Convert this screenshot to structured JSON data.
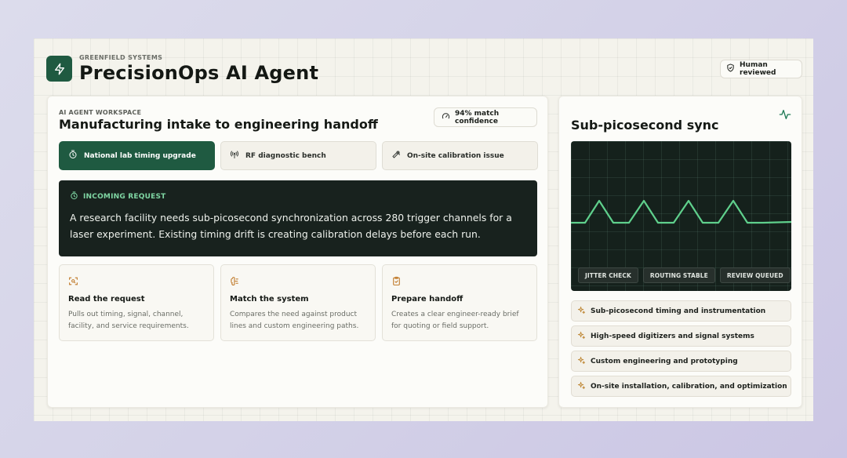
{
  "header": {
    "kicker": "GREENFIELD SYSTEMS",
    "title": "PrecisionOps AI Agent",
    "reviewed_label": "Human reviewed"
  },
  "workspace": {
    "kicker": "AI AGENT WORKSPACE",
    "title": "Manufacturing intake to engineering handoff",
    "confidence_label": "94% match confidence",
    "tabs": [
      {
        "label": "National lab timing upgrade",
        "icon": "timer-icon",
        "active": true
      },
      {
        "label": "RF diagnostic bench",
        "icon": "antenna-icon",
        "active": false
      },
      {
        "label": "On-site calibration issue",
        "icon": "wrench-icon",
        "active": false
      }
    ],
    "request": {
      "heading": "INCOMING REQUEST",
      "body": "A research facility needs sub-picosecond synchronization across 280 trigger channels for a laser experiment. Existing timing drift is creating calibration delays before each run."
    },
    "steps": [
      {
        "title": "Read the request",
        "desc": "Pulls out timing, signal, channel, facility, and service requirements.",
        "icon": "scan-icon"
      },
      {
        "title": "Match the system",
        "desc": "Compares the need against product lines and custom engineering paths.",
        "icon": "brain-icon"
      },
      {
        "title": "Prepare handoff",
        "desc": "Creates a clear engineer-ready brief for quoting or field support.",
        "icon": "clipboard-check-icon"
      }
    ]
  },
  "sync": {
    "title": "Sub-picosecond sync",
    "badges": [
      "JITTER CHECK",
      "ROUTING STABLE",
      "REVIEW QUEUED"
    ],
    "features": [
      "Sub-picosecond timing and instrumentation",
      "High-speed digitizers and signal systems",
      "Custom engineering and prototyping",
      "On-site installation, calibration, and optimization"
    ]
  },
  "colors": {
    "accent": "#1f5a41",
    "dark_panel": "#18221e",
    "signal": "#5fd08c",
    "sparkle": "#c08a3a"
  }
}
